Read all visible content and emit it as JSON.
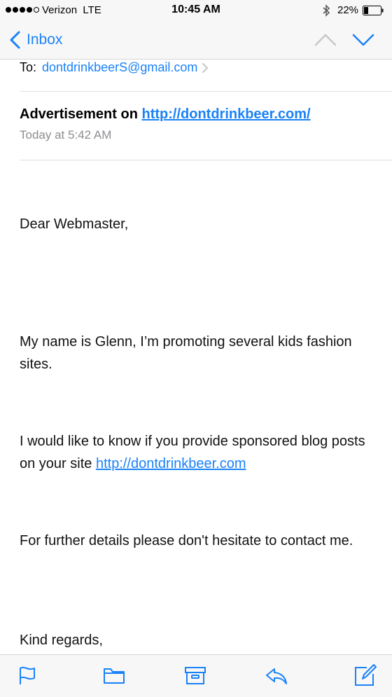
{
  "status_bar": {
    "carrier": "Verizon",
    "network": "LTE",
    "time": "10:45 AM",
    "battery": "22%",
    "icons": [
      "signal-dots",
      "bluetooth-icon",
      "battery-icon"
    ]
  },
  "nav": {
    "back_label": "Inbox",
    "icons": [
      "chevron-left-icon",
      "chevron-up-icon",
      "chevron-down-icon"
    ]
  },
  "header": {
    "to_label": "To:",
    "to_address": "dontdrinkbeerS@gmail.com",
    "subject_prefix": "Advertisement on ",
    "subject_link": "http://dontdrinkbeer.com/",
    "date": "Today at 5:42 AM"
  },
  "body": {
    "greeting": "Dear Webmaster,",
    "intro": "My name is Glenn, I’m promoting several kids fashion sites.",
    "request_text": "I would like to know if you provide sponsored blog posts on your site ",
    "request_link": "http://dontdrinkbeer.com",
    "details": "For further details please don't hesitate to contact me.",
    "closing": "Kind regards,"
  },
  "toolbar": {
    "icons": [
      "flag-icon",
      "folder-icon",
      "archive-icon",
      "reply-icon",
      "compose-icon"
    ]
  },
  "colors": {
    "accent": "#1a82f7",
    "bar_background": "#f7f7f7",
    "secondary_text": "#8e8e93"
  }
}
